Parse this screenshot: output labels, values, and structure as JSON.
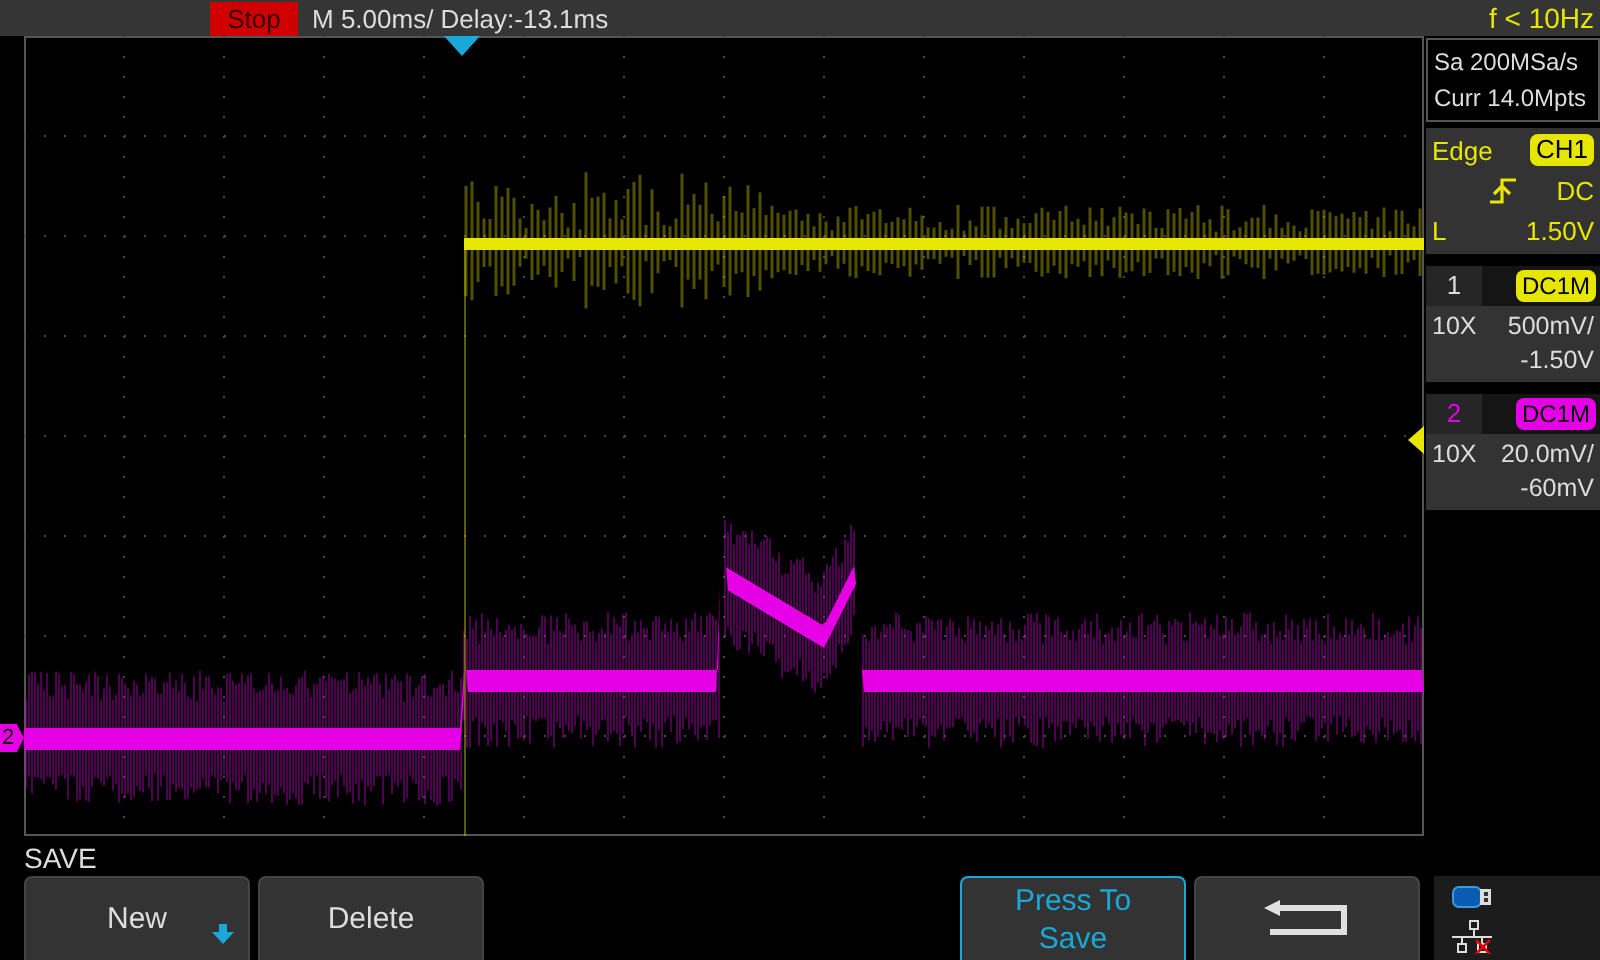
{
  "status": {
    "run_state": "Stop",
    "timebase": "M 5.00ms/ Delay:-13.1ms",
    "frequency": "f < 10Hz"
  },
  "acquisition": {
    "sample_rate": "Sa 200MSa/s",
    "memory": "Curr 14.0Mpts"
  },
  "trigger": {
    "type": "Edge",
    "source": "CH1",
    "coupling": "DC",
    "level_label": "L",
    "level_value": "1.50V"
  },
  "channels": [
    {
      "number": "1",
      "coupling": "DC1M",
      "probe": "10X",
      "scale": "500mV/",
      "offset": "-1.50V",
      "color": "#e6e600"
    },
    {
      "number": "2",
      "coupling": "DC1M",
      "probe": "10X",
      "scale": "20.0mV/",
      "offset": "-60mV",
      "color": "#e600e6",
      "marker_label": "2"
    }
  ],
  "menu": {
    "title": "SAVE",
    "buttons": [
      {
        "kind": "dropdown",
        "label": "New",
        "highlighted": false
      },
      {
        "kind": "plain",
        "label": "Delete",
        "highlighted": false
      },
      {
        "kind": "blank"
      },
      {
        "kind": "blank"
      },
      {
        "kind": "plain",
        "label": "Press To Save",
        "highlighted": true
      },
      {
        "kind": "back",
        "highlighted": false
      }
    ]
  }
}
